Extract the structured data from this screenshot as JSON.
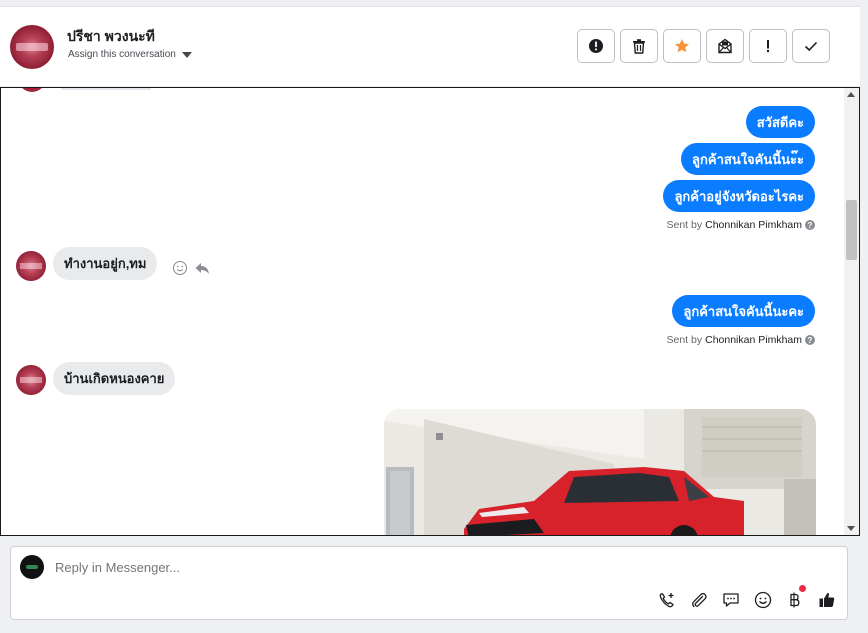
{
  "header": {
    "contact_name": "ปรีชา พวงนะที",
    "assign_label": "Assign this conversation",
    "actions": [
      {
        "id": "spam",
        "icon": "alert-circle-icon"
      },
      {
        "id": "delete",
        "icon": "trash-icon"
      },
      {
        "id": "star",
        "icon": "star-icon",
        "color": "#f7923b"
      },
      {
        "id": "unread",
        "icon": "mail-open-icon"
      },
      {
        "id": "important",
        "icon": "exclamation-icon"
      },
      {
        "id": "done",
        "icon": "check-icon"
      }
    ]
  },
  "messages": {
    "out1": "สวัสดีคะ",
    "out2": "ลูกค้าสนใจคันนี้นะ๊ะ",
    "out3": "ลูกค้าอยู่จังหวัดอะไรคะ",
    "sent_by_label": "Sent by",
    "sent_by_name": "Chonnikan Pimkham",
    "in1": "ทำงานอยู่ก,ทม",
    "out4": "ลูกค้าสนใจคันนี้นะคะ",
    "in2": "บ้านเกิดหนองคาย",
    "sent2_label": "Sent by",
    "sent2_name": "Chonnikan Pimkham"
  },
  "composer": {
    "placeholder": "Reply in Messenger...",
    "tools": [
      "phone-plus-icon",
      "paperclip-icon",
      "chat-bubble-icon",
      "emoji-icon",
      "baht-icon",
      "thumbs-up-icon"
    ]
  },
  "colors": {
    "outgoing_bubble": "#0a7cff",
    "incoming_bubble": "#e9eaec",
    "star": "#f7923b",
    "notification_dot": "#f02849"
  }
}
